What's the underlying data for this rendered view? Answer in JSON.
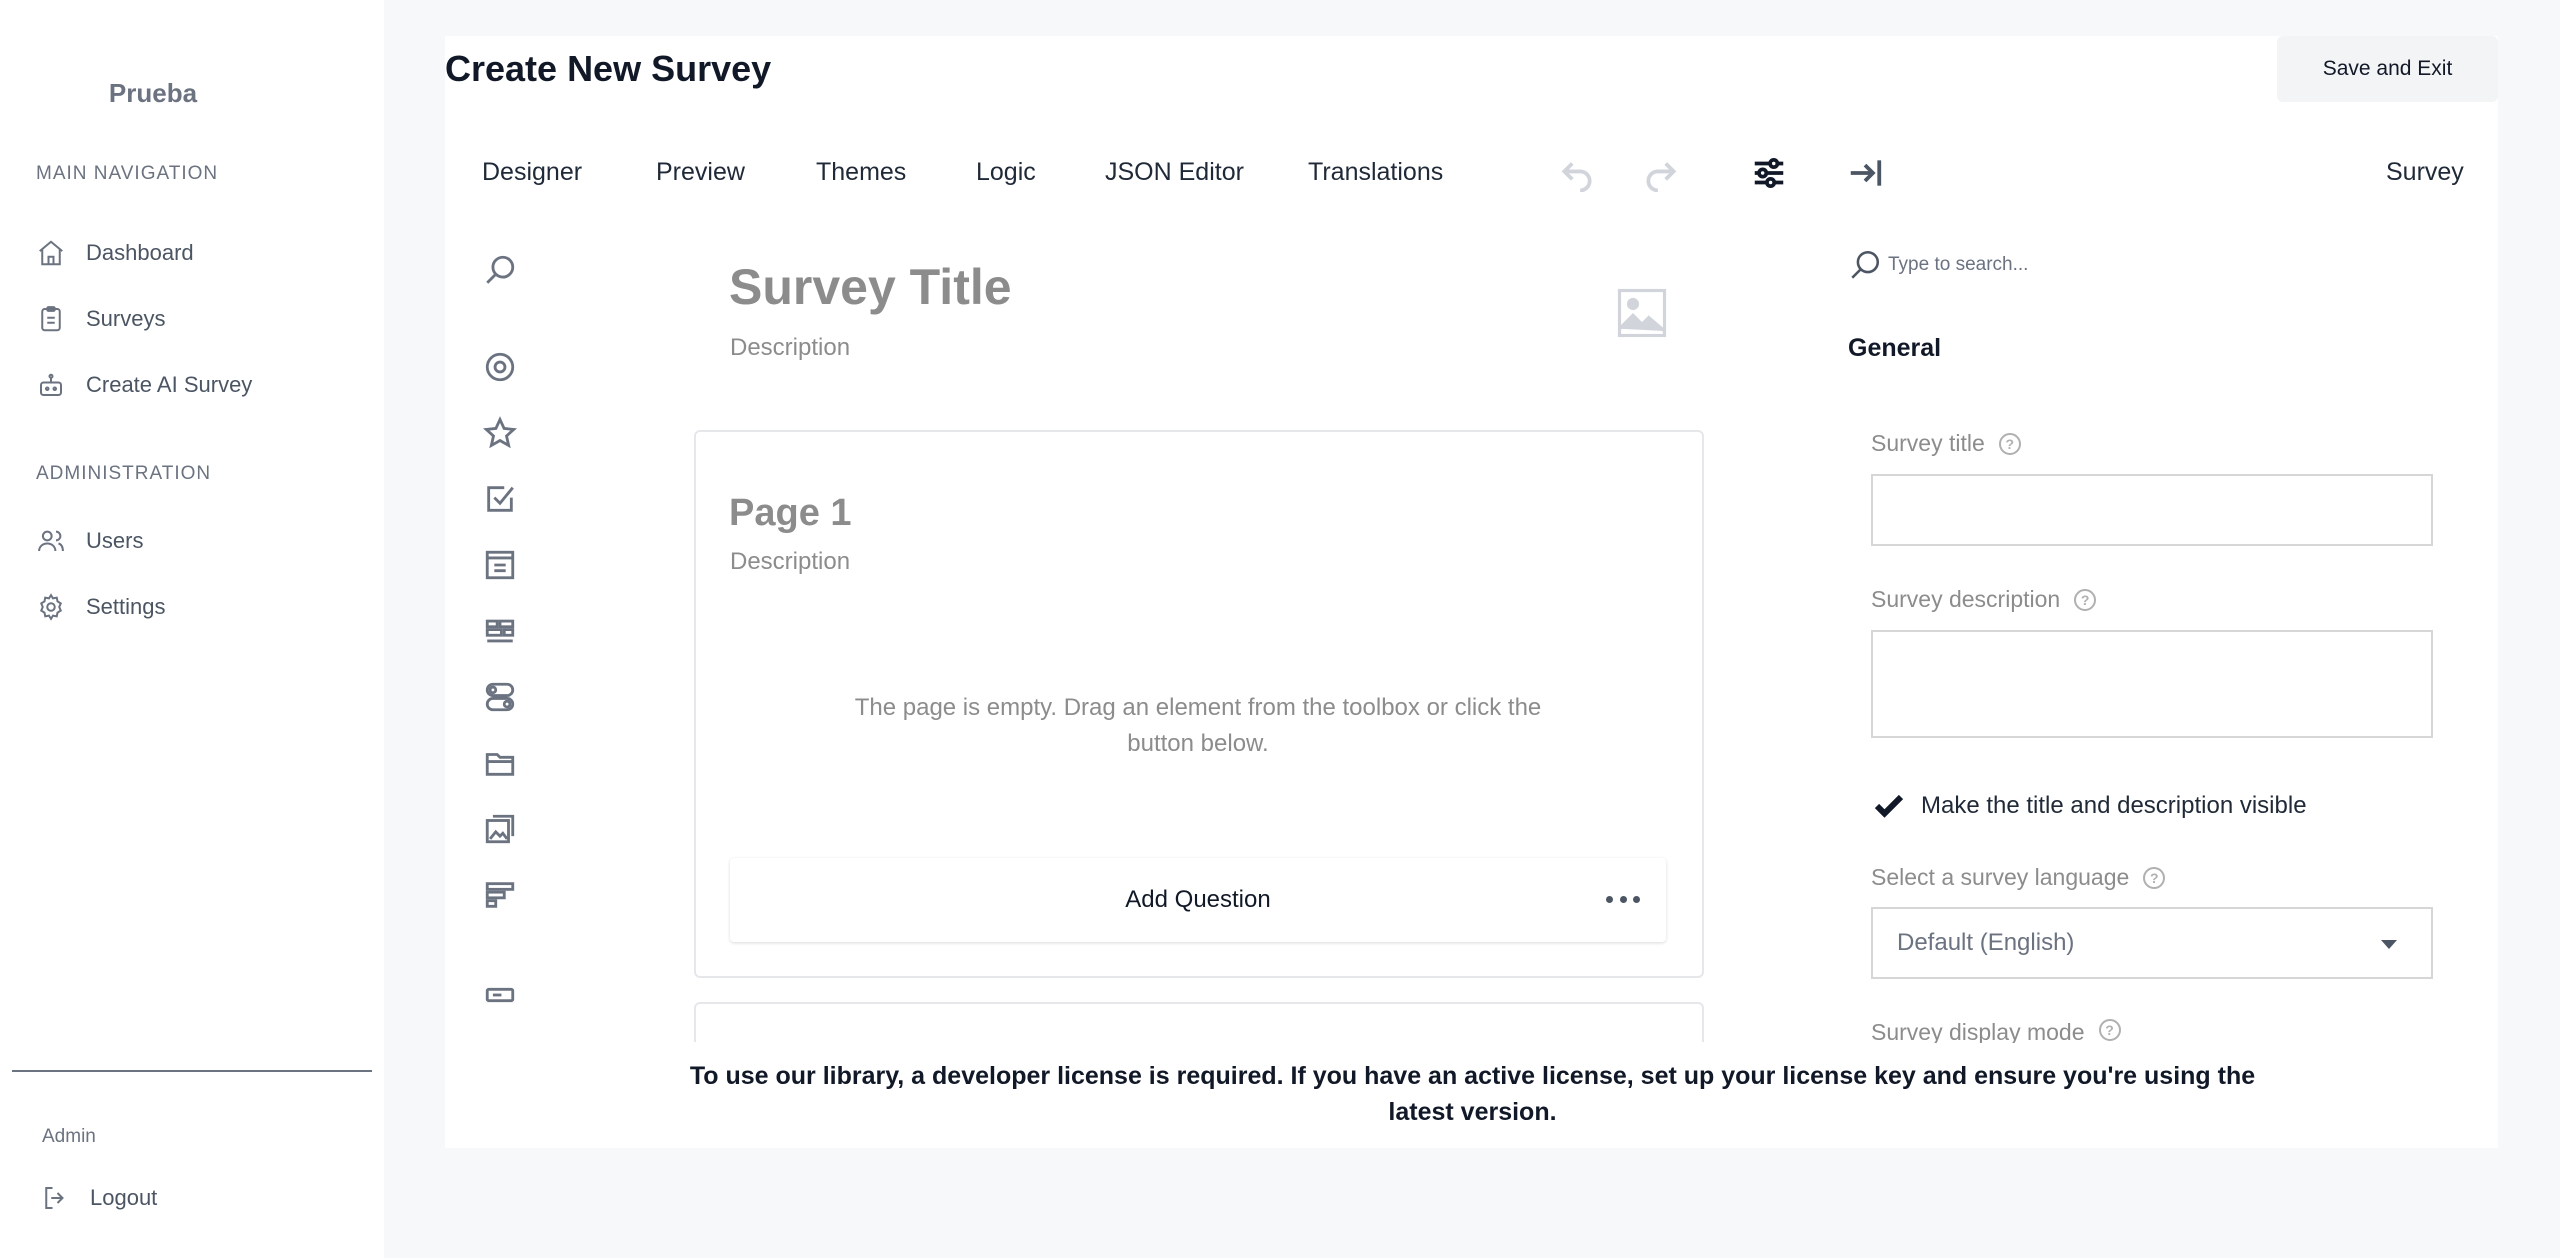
{
  "sidebar": {
    "brand": "Prueba",
    "main_nav_label": "MAIN NAVIGATION",
    "main_nav": [
      {
        "label": "Dashboard",
        "icon": "home-icon"
      },
      {
        "label": "Surveys",
        "icon": "clipboard-icon"
      },
      {
        "label": "Create AI Survey",
        "icon": "robot-icon"
      }
    ],
    "admin_label": "ADMINISTRATION",
    "admin_nav": [
      {
        "label": "Users",
        "icon": "users-icon"
      },
      {
        "label": "Settings",
        "icon": "gear-icon"
      }
    ],
    "user_role": "Admin",
    "logout_label": "Logout"
  },
  "header": {
    "title": "Create New Survey",
    "save_label": "Save and Exit"
  },
  "tabs": [
    "Designer",
    "Preview",
    "Themes",
    "Logic",
    "JSON Editor",
    "Translations"
  ],
  "active_tab": "Designer",
  "survey_tab_label": "Survey",
  "canvas": {
    "survey_title": "Survey Title",
    "survey_description": "Description",
    "page_title": "Page 1",
    "page_description": "Description",
    "empty_message": "The page is empty. Drag an element from the toolbox or click the button below.",
    "add_question_label": "Add Question"
  },
  "property_grid": {
    "search_placeholder": "Type to search...",
    "category": "General",
    "survey_title_label": "Survey title",
    "survey_title_value": "",
    "survey_description_label": "Survey description",
    "survey_description_value": "",
    "visible_checkbox_label": "Make the title and description visible",
    "visible_checked": true,
    "language_label": "Select a survey language",
    "language_value": "Default (English)",
    "display_mode_label": "Survey display mode"
  },
  "license_message": "To use our library, a developer license is required. If you have an active license, set up your license key and ensure you're using the latest version.",
  "colors": {
    "accent": "#111827",
    "muted_text": "#8c8c8c",
    "sidebar_text": "#4b5563",
    "background": "#f7f8fa"
  }
}
